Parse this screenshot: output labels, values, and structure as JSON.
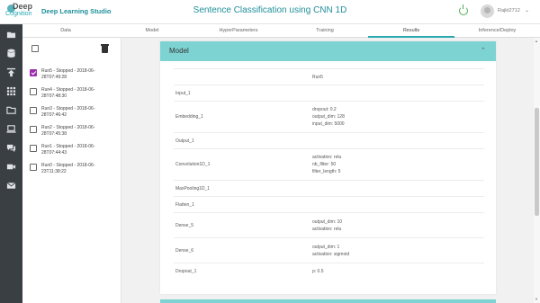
{
  "header": {
    "logo_top": "Deep",
    "logo_bottom": "Cognition",
    "studio_name": "Deep Learning Studio",
    "page_title": "Sentence Classification using CNN 1D",
    "username": "Rajkt2712",
    "accent_color": "#2aa9b3"
  },
  "sidebar": {
    "icons": [
      "folder-plus-icon",
      "database-icon",
      "upload-icon",
      "grid-icon",
      "folder-icon",
      "laptop-icon",
      "chat-icon",
      "video-icon",
      "mail-icon"
    ]
  },
  "tabs": [
    {
      "label": "Data"
    },
    {
      "label": "Model"
    },
    {
      "label": "HyperParameters"
    },
    {
      "label": "Training"
    },
    {
      "label": "Results"
    },
    {
      "label": "Inference/Deploy"
    }
  ],
  "active_tab": "Results",
  "runs": [
    {
      "label": "Run5 - Stopped - 2018-06-28T07:49:28",
      "checked": true
    },
    {
      "label": "Run4 - Stopped - 2018-06-28T07:48:30",
      "checked": false
    },
    {
      "label": "Run3 - Stopped - 2018-06-28T07:46:42",
      "checked": false
    },
    {
      "label": "Run2 - Stopped - 2018-06-28T07:45:38",
      "checked": false
    },
    {
      "label": "Run1 - Stopped - 2018-06-28T07:44:43",
      "checked": false
    },
    {
      "label": "Run0 - Stopped - 2018-06-23T11:38:22",
      "checked": false
    }
  ],
  "model_card": {
    "title": "Model",
    "column_header": "Run5",
    "layers": [
      {
        "name": "Input_1",
        "params": []
      },
      {
        "name": "Embedding_1",
        "params": [
          "dropout: 0.2",
          "output_dim: 128",
          "input_dim: 5000"
        ]
      },
      {
        "name": "Output_1",
        "params": []
      },
      {
        "name": "Convolution1D_1",
        "params": [
          "activation: relu",
          "nb_filter: 50",
          "filter_length: 5"
        ]
      },
      {
        "name": "MaxPooling1D_1",
        "params": []
      },
      {
        "name": "Flatten_1",
        "params": []
      },
      {
        "name": "Dense_5",
        "params": [
          "output_dim: 10",
          "activation: relu"
        ]
      },
      {
        "name": "Dense_6",
        "params": [
          "output_dim: 1",
          "activation: sigmoid"
        ]
      },
      {
        "name": "Dropout_1",
        "params": [
          "p: 0.5"
        ]
      }
    ]
  }
}
